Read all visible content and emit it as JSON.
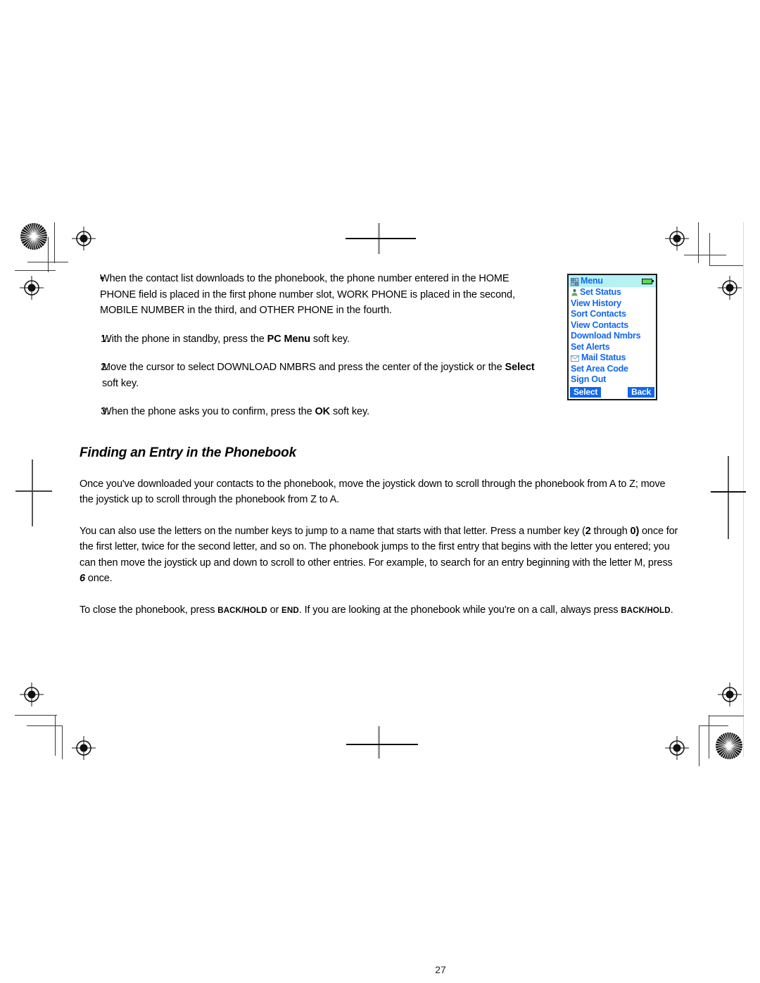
{
  "page": {
    "number": "27"
  },
  "bullet": {
    "marker": "•",
    "text": "When the contact list downloads to the phonebook, the phone number entered in the HOME PHONE field is placed in the first phone number slot, WORK PHONE is placed in the second, MOBILE NUMBER in the third, and OTHER PHONE in the fourth."
  },
  "steps": [
    {
      "number": "1.",
      "parts": [
        {
          "t": "With the phone in standby, press the ",
          "style": "normal"
        },
        {
          "t": "PC Menu",
          "style": "bold"
        },
        {
          "t": " soft key.",
          "style": "normal"
        }
      ]
    },
    {
      "number": "2.",
      "parts": [
        {
          "t": "Move the cursor to select DOWNLOAD NMBRS and press the center of the joystick or the ",
          "style": "normal"
        },
        {
          "t": "Select",
          "style": "bold"
        },
        {
          "t": " soft key.",
          "style": "normal"
        }
      ]
    },
    {
      "number": "3.",
      "parts": [
        {
          "t": "When the phone asks you to confirm, press the ",
          "style": "normal"
        },
        {
          "t": "OK",
          "style": "bold"
        },
        {
          "t": " soft key.",
          "style": "normal"
        }
      ]
    }
  ],
  "section": {
    "title": "Finding an Entry in the Phonebook",
    "paragraph1": "Once you've downloaded your contacts to the phonebook, move the joystick down to scroll through the phonebook from A to Z; move the joystick up to scroll through the phonebook from Z to A.",
    "paragraph2_parts": [
      {
        "t": "You can also use the letters on the number keys to jump to a name that starts with that letter. Press a number key (",
        "style": "normal"
      },
      {
        "t": "2",
        "style": "bold"
      },
      {
        "t": " through ",
        "style": "normal"
      },
      {
        "t": "0)",
        "style": "bold"
      },
      {
        "t": " once for the first letter, twice for the second letter, and so on. The phonebook jumps to the first entry that begins with the letter you entered; you can then move the joystick up and down to scroll to other entries. For example, to search for an entry beginning with the letter M, press ",
        "style": "normal"
      },
      {
        "t": "6",
        "style": "bolditalic"
      },
      {
        "t": " once.",
        "style": "normal"
      }
    ],
    "paragraph3_parts": [
      {
        "t": "To close the phonebook, press ",
        "style": "normal"
      },
      {
        "t": "BACK/HOLD",
        "style": "smallcaps"
      },
      {
        "t": " or ",
        "style": "normal"
      },
      {
        "t": "END",
        "style": "smallcaps"
      },
      {
        "t": ". If you are looking at the phonebook while you're on a call, always press ",
        "style": "normal"
      },
      {
        "t": "BACK/HOLD",
        "style": "smallcaps"
      },
      {
        "t": ".",
        "style": "normal"
      }
    ]
  },
  "phone_screen": {
    "header": {
      "title": "Menu",
      "icon": "menu-grid-icon",
      "battery_icon": "battery-icon",
      "background_color": "#b4f2f4",
      "text_color": "#1168ef"
    },
    "menu_items": [
      {
        "label": "Set Status",
        "icon": "person-icon"
      },
      {
        "label": "View History",
        "icon": null
      },
      {
        "label": "Sort Contacts",
        "icon": null
      },
      {
        "label": "View Contacts",
        "icon": null
      },
      {
        "label": "Download Nmbrs",
        "icon": null
      },
      {
        "label": "Set Alerts",
        "icon": null
      },
      {
        "label": "Mail Status",
        "icon": "envelope-icon"
      },
      {
        "label": "Set Area Code",
        "icon": null
      },
      {
        "label": "Sign Out",
        "icon": null
      }
    ],
    "softkeys": {
      "left": "Select",
      "right": "Back",
      "background_color": "#1168ef",
      "text_color": "#ffffff"
    }
  }
}
